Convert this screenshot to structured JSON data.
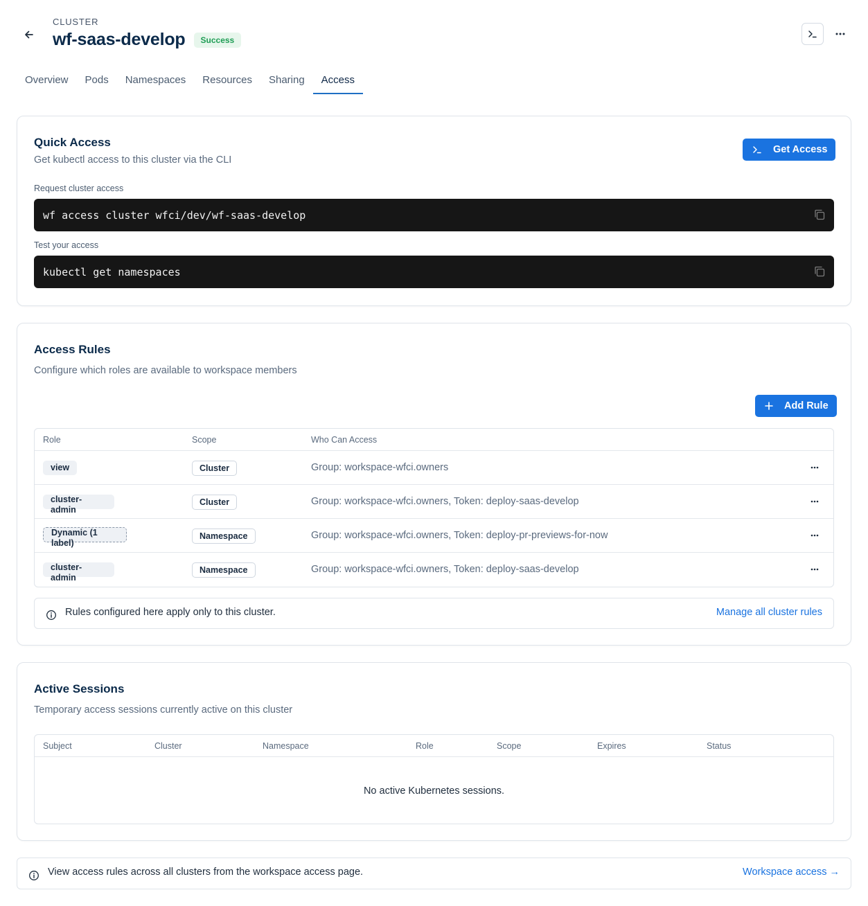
{
  "header": {
    "eyebrow": "CLUSTER",
    "title": "wf-saas-develop",
    "status": "Success",
    "status_color": "#1f9d55"
  },
  "tabs": [
    {
      "label": "Overview"
    },
    {
      "label": "Pods"
    },
    {
      "label": "Namespaces"
    },
    {
      "label": "Resources"
    },
    {
      "label": "Sharing"
    },
    {
      "label": "Access"
    }
  ],
  "active_tab": "Access",
  "quick_access": {
    "title": "Quick Access",
    "subtitle": "Get kubectl access to this cluster via the CLI",
    "button": "Get Access",
    "request_label": "Request cluster access",
    "request_cmd": "wf access cluster wfci/dev/wf-saas-develop",
    "test_label": "Test your access",
    "test_cmd": "kubectl get namespaces"
  },
  "access_rules": {
    "title": "Access Rules",
    "subtitle": "Configure which roles are available to workspace members",
    "add_button": "Add Rule",
    "columns": [
      "Role",
      "Scope",
      "Who Can Access"
    ],
    "rows": [
      {
        "role": "view",
        "scope": "Cluster",
        "who": "Group: workspace-wfci.owners"
      },
      {
        "role": "cluster-admin",
        "scope": "Cluster",
        "who": "Group: workspace-wfci.owners, Token: deploy-saas-develop"
      },
      {
        "role": "Dynamic (1 label)",
        "scope": "Namespace",
        "who": "Group: workspace-wfci.owners, Token: deploy-pr-previews-for-now"
      },
      {
        "role": "cluster-admin",
        "scope": "Namespace",
        "who": "Group: workspace-wfci.owners, Token: deploy-saas-develop"
      }
    ],
    "info_text": "Rules configured here apply only to this cluster.",
    "info_link": "Manage all cluster rules"
  },
  "active_sessions": {
    "title": "Active Sessions",
    "subtitle": "Temporary access sessions currently active on this cluster",
    "columns": [
      "Subject",
      "Cluster",
      "Namespace",
      "Role",
      "Scope",
      "Expires",
      "Status"
    ],
    "empty": "No active Kubernetes sessions."
  },
  "footer": {
    "text": "View access rules across all clusters from the workspace access page.",
    "link": "Workspace access",
    "link_arrow": "→"
  },
  "colors": {
    "accent": "#1a73e0",
    "heading": "#0b2a4a",
    "code_bg": "#161616"
  }
}
